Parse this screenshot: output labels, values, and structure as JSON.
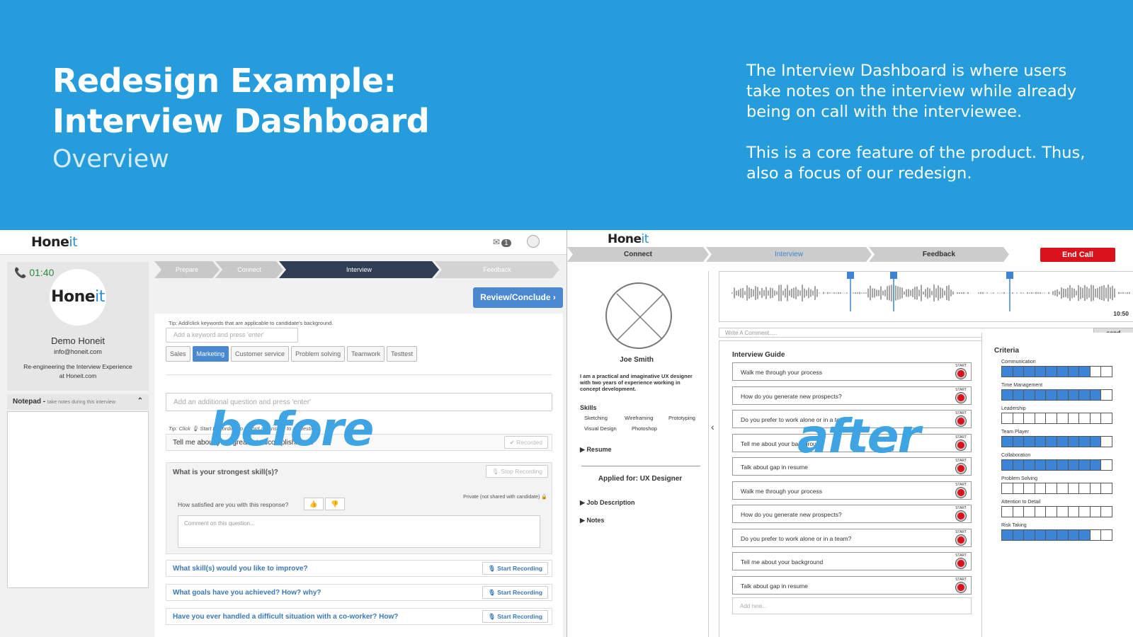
{
  "hero": {
    "title_line1": "Redesign Example:",
    "title_line2": "Interview Dashboard",
    "subtitle": "Overview",
    "desc_p1": "The Interview Dashboard is where users take notes on the interview while already being on call with the interviewee.",
    "desc_p2": "This is a core feature of the product. Thus, also a focus of our redesign."
  },
  "before": {
    "overlay": "before",
    "logo": {
      "a": "Hone",
      "b": "it"
    },
    "mail_count": "1",
    "timer": "01:40",
    "profile": {
      "name": "Demo Honeit",
      "email": "info@honeit.com",
      "tagline": "Re-engineering the Interview Experience at Honeit.com"
    },
    "notepad": {
      "label": "Notepad - ",
      "hint": "take notes during this interview"
    },
    "steps": [
      "Prepare",
      "Connect",
      "Interview",
      "Feedback"
    ],
    "review_button": "Review/Conclude ›",
    "tip1": "Tip: Add/click keywords that are applicable to candidate's background.",
    "keyword_placeholder": "Add a keyword and press 'enter'",
    "keywords": [
      "Sales",
      "Marketing",
      "Customer service",
      "Problem solving",
      "Teamwork",
      "Testtest"
    ],
    "question_placeholder": "Add an additional question and press 'enter'",
    "tip2": "Tip: Click 🎙 Start Recording to record an answer to a question.",
    "questions": [
      {
        "text": "Tell me about your greatest accomplishment.",
        "button": "✔ Recorded"
      },
      {
        "text": "What is your strongest skill(s)?",
        "button": "🎙 Stop Recording"
      },
      {
        "text": "What skill(s) would you like to improve?",
        "button": "🎙 Start Recording"
      },
      {
        "text": "What goals have you achieved? How? why?",
        "button": "🎙 Start Recording"
      },
      {
        "text": "Have you ever handled a difficult situation with a co-worker? How?",
        "button": "🎙 Start Recording"
      }
    ],
    "satisfied": "How satisfied are you with this response?",
    "private": "Private (not shared with candidate) 🔒",
    "comment_placeholder": "Comment on this question..."
  },
  "after": {
    "overlay": "after",
    "logo": {
      "a": "Hone",
      "b": "it"
    },
    "steps": [
      "Connect",
      "Interview",
      "Feedback"
    ],
    "end_call": "End Call",
    "candidate": {
      "name": "Joe Smith",
      "bio": "I am a practical and imaginative UX designer with two years of experience working in concept development.",
      "skills_label": "Skills",
      "skills": [
        "Sketching",
        "Wireframing",
        "Prototyping",
        "Visual Design",
        "Photoshop"
      ],
      "resume": "Resume",
      "applied": "Applied for: UX Designer",
      "job_description": "Job Description",
      "notes": "Notes"
    },
    "time": "10:50",
    "comment_placeholder": "Write A Comment.....",
    "send": "send",
    "guide_title": "Interview Guide",
    "start_label": "START",
    "guide_items": [
      "Walk me through your process",
      "How do you generate new prospects?",
      "Do you prefer to work alone or in a team?",
      "Tell me about your background",
      "Talk about gap in resume",
      "Walk me through your process",
      "How do you generate new prospects?",
      "Do you prefer to work alone or in a team?",
      "Tell me about your background",
      "Talk about gap in resume"
    ],
    "add_new": "Add new...",
    "criteria_title": "Criteria",
    "criteria": [
      {
        "label": "Communication",
        "score": 8
      },
      {
        "label": "Time Management",
        "score": 9
      },
      {
        "label": "Leadership",
        "score": 0
      },
      {
        "label": "Team Player",
        "score": 9
      },
      {
        "label": "Collaboration",
        "score": 9
      },
      {
        "label": "Problem Solving",
        "score": 0
      },
      {
        "label": "Attention to Detail",
        "score": 0
      },
      {
        "label": "Risk Taking",
        "score": 8
      }
    ],
    "criteria_max": 10,
    "colors": {
      "accent": "#3c84d6",
      "end_call": "#d9121b"
    }
  }
}
